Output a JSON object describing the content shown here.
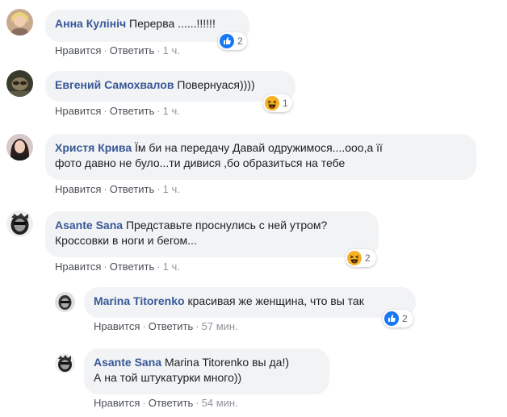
{
  "action_labels": {
    "like": "Нравится",
    "reply": "Ответить",
    "separator": "·"
  },
  "comments": [
    {
      "author": "Анна Кулініч",
      "text": "Перерва ......!!!!!!",
      "time": "1 ч.",
      "reaction": "like-icon",
      "reaction_count": "2"
    },
    {
      "author": "Евгений Самохвалов",
      "text": "Повернуася))))",
      "time": "1 ч.",
      "reaction": "haha-icon",
      "reaction_count": "1"
    },
    {
      "author": "Христя Крива",
      "text_line1": "Їм би на передачу Давай одружимося....ооо,а її",
      "text_line2": "фото давно не було...ти дивися ,бо образиться на тебе",
      "time": "1 ч."
    },
    {
      "author": "Asante Sana",
      "text_line1": "Представьте проснулись с ней утром?",
      "text_line2": "Кроссовки в ноги и бегом...",
      "time": "1 ч.",
      "reaction": "haha-icon",
      "reaction_count": "2"
    },
    {
      "author": "Marina Titorenko",
      "text": "красивая же женщина, что вы так",
      "time": "57 мин.",
      "reaction": "like-icon",
      "reaction_count": "2"
    },
    {
      "author": "Asante Sana",
      "text_line1": "Marina Titorenko вы да!)",
      "text_line2": "А на той штукатурки много))",
      "time": "54 мин."
    }
  ],
  "colors": {
    "author": "#385898",
    "bubble": "#f2f3f5",
    "like": "#1877f2",
    "haha": "#f7b125"
  }
}
